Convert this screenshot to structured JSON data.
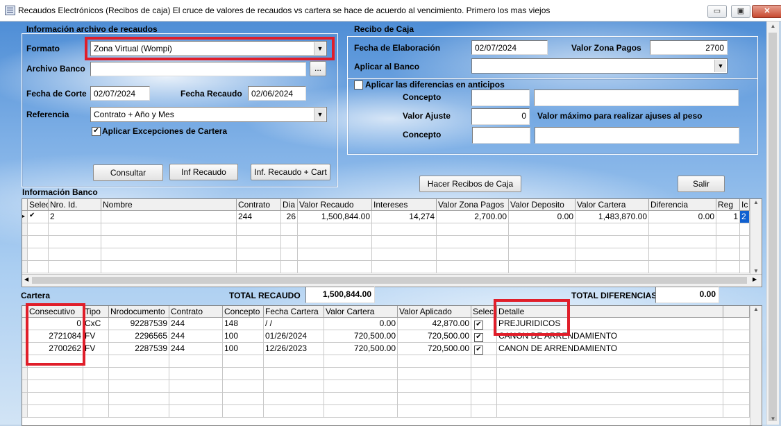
{
  "window": {
    "title": "Recaudos Electrónicos (Recibos de caja) El  cruce de valores de recaudos vs cartera se hace de acuerdo al vencimiento. Primero los mas viejos",
    "min_glyph": "▭",
    "max_glyph": "▣",
    "close_glyph": "✕"
  },
  "archivo": {
    "group_title": "Información archivo de recaudos",
    "formato_label": "Formato",
    "formato_value": "Zona Virtual (Wompi)",
    "archivo_banco_label": "Archivo Banco",
    "archivo_banco_value": "",
    "browse_label": "...",
    "fecha_corte_label": "Fecha de Corte",
    "fecha_corte_value": "02/07/2024",
    "fecha_recaudo_label": "Fecha Recaudo",
    "fecha_recaudo_value": "02/06/2024",
    "referencia_label": "Referencia",
    "referencia_value": "Contrato + Año y Mes",
    "excepciones_label": "Aplicar Excepciones de Cartera",
    "excepciones_checked": true,
    "consultar_label": "Consultar",
    "inf_recaudo_label": "Inf Recaudo",
    "inf_recaudo_cart_label": "Inf. Recaudo + Cart"
  },
  "recibo": {
    "group_title": "Recibo de Caja",
    "fecha_elab_label": "Fecha de Elaboración",
    "fecha_elab_value": "02/07/2024",
    "valor_zona_label": "Valor Zona Pagos",
    "valor_zona_value": "2700",
    "aplicar_banco_label": "Aplicar al Banco",
    "aplicar_banco_value": "",
    "diferencias_label": "Aplicar las diferencias en anticipos",
    "diferencias_checked": false,
    "concepto_label": "Concepto",
    "valor_ajuste_label": "Valor Ajuste",
    "valor_ajuste_value": "0",
    "valor_maximo_label": "Valor máximo para realizar ajuses al peso",
    "concepto2_label": "Concepto"
  },
  "actions": {
    "hacer_recibos_label": "Hacer Recibos de Caja",
    "salir_label": "Salir"
  },
  "banco": {
    "title": "Información Banco",
    "columns": [
      "Selec",
      "Nro. Id.",
      "Nombre",
      "Contrato",
      "Dia",
      "Valor Recaudo",
      "Intereses",
      "Valor Zona Pagos",
      "Valor Deposito",
      "Valor Cartera",
      "Diferencia",
      "Reg",
      "Ic"
    ],
    "rows": [
      {
        "selec": true,
        "nro_id": "2",
        "nombre": "",
        "contrato": "244",
        "dia": "26",
        "valor_recaudo": "1,500,844.00",
        "intereses": "14,274",
        "valor_zona": "2,700.00",
        "valor_deposito": "0.00",
        "valor_cartera": "1,483,870.00",
        "diferencia": "0.00",
        "reg": "1",
        "ic": "2"
      }
    ]
  },
  "totales": {
    "cartera_title": "Cartera",
    "total_recaudo_label": "TOTAL RECAUDO",
    "total_recaudo_value": "1,500,844.00",
    "total_diferencias_label": "TOTAL DIFERENCIAS",
    "total_diferencias_value": "0.00"
  },
  "cartera": {
    "columns": [
      "Consecutivo",
      "Tipo",
      "Nrodocumento",
      "Contrato",
      "Concepto",
      "Fecha Cartera",
      "Valor Cartera",
      "Valor Aplicado",
      "Selec",
      "Detalle"
    ],
    "rows": [
      {
        "consecutivo": "0",
        "tipo": "CxC",
        "nrodoc": "92287539",
        "contrato": "244",
        "concepto": "148",
        "fecha": "/  /",
        "valor_cartera": "0.00",
        "valor_aplicado": "42,870.00",
        "selec": true,
        "detalle": "PREJURIDICOS"
      },
      {
        "consecutivo": "2721084",
        "tipo": "FV",
        "nrodoc": "2296565",
        "contrato": "244",
        "concepto": "100",
        "fecha": "01/26/2024",
        "valor_cartera": "720,500.00",
        "valor_aplicado": "720,500.00",
        "selec": true,
        "detalle": "CANON DE ARRENDAMIENTO"
      },
      {
        "consecutivo": "2700262",
        "tipo": "FV",
        "nrodoc": "2287539",
        "contrato": "244",
        "concepto": "100",
        "fecha": "12/26/2023",
        "valor_cartera": "720,500.00",
        "valor_aplicado": "720,500.00",
        "selec": true,
        "detalle": "CANON DE ARRENDAMIENTO"
      }
    ]
  },
  "colors": {
    "highlight": "#e01e2a",
    "row_selected": "#1060d0"
  }
}
